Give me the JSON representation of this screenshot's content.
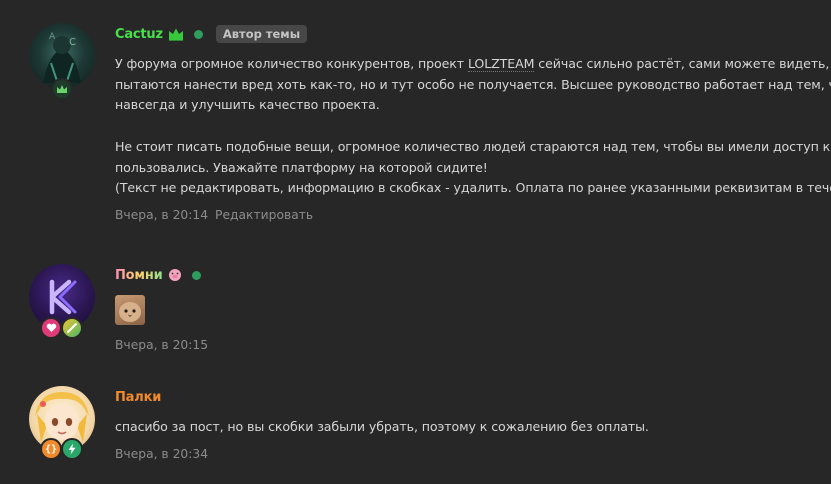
{
  "posts": [
    {
      "username": "Cactuz",
      "author_tag": "Автор темы",
      "lines": [
        "У форума огромное количество конкурентов, проект ",
        "пытаются нанести вред хоть как-то, но и тут особо не получается. Высшее руководство работает над тем, чтобы",
        "навсегда и улучшить качество проекта.",
        "",
        "Не стоит писать подобные вещи, огромное количество людей стараются над тем, чтобы вы имели доступ к плат",
        "пользовались. Уважайте платформу на которой сидите!",
        "(Текст не редактировать, информацию в скобках - удалить. Оплата по ранее указанными реквизитам в течение"
      ],
      "link_word": "LOLZTEAM",
      "line1_tail": " сейчас сильно растёт, сами можете видеть, что р",
      "time": "Вчера, в 20:14",
      "edit": "Редактировать"
    },
    {
      "username": "Помни",
      "time": "Вчера, в 20:15"
    },
    {
      "username": "Палки",
      "text": "спасибо за пост, но вы скобки забыли убрать, поэтому к сожалению без оплаты.",
      "time": "Вчера, в 20:34"
    }
  ],
  "colors": {
    "background": "#272727",
    "cactuz_name": "#47e04a",
    "palki_name": "#f08a2a",
    "online": "#2f9d5e",
    "meta": "#8c8c8c"
  },
  "icons": [
    "crown-icon",
    "heart-icon",
    "brush-icon",
    "braces-icon",
    "lightning-icon",
    "cat-sticker"
  ]
}
